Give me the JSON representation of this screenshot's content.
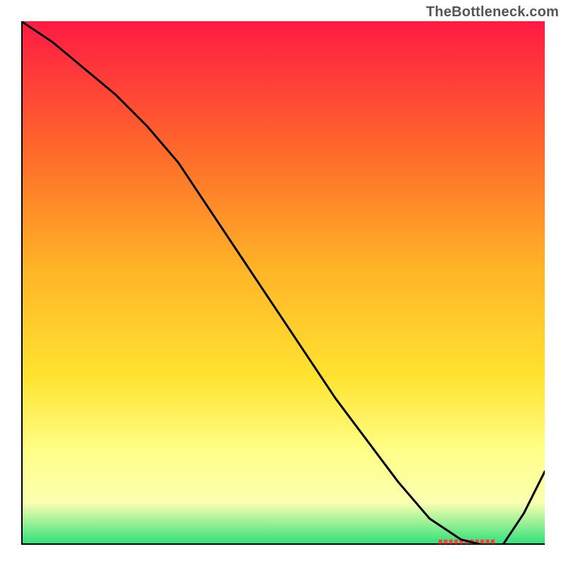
{
  "watermark": "TheBottleneck.com",
  "marker_label": "",
  "colors": {
    "grad_top": "#ff1a44",
    "grad_mid1": "#ff6a2a",
    "grad_mid2": "#ffb627",
    "grad_mid3": "#ffe330",
    "grad_mid4": "#ffff88",
    "grad_mid5": "#fbffb0",
    "grad_bottom": "#2de07a",
    "axis": "#000000",
    "curve": "#000000",
    "marker": "#ff3a3a"
  },
  "chart_data": {
    "type": "line",
    "title": "",
    "xlabel": "",
    "ylabel": "",
    "xlim": [
      0,
      100
    ],
    "ylim": [
      0,
      100
    ],
    "axes_visible": {
      "left": true,
      "bottom": true,
      "ticks": false
    },
    "gradient_stops": [
      {
        "pos": 0.0,
        "color": "#ff1a44"
      },
      {
        "pos": 0.25,
        "color": "#ff6a2a"
      },
      {
        "pos": 0.48,
        "color": "#ffb627"
      },
      {
        "pos": 0.68,
        "color": "#ffe330"
      },
      {
        "pos": 0.82,
        "color": "#ffff88"
      },
      {
        "pos": 0.92,
        "color": "#fbffb0"
      },
      {
        "pos": 1.0,
        "color": "#2de07a"
      }
    ],
    "series": [
      {
        "name": "curve",
        "x": [
          0,
          6,
          12,
          18,
          24,
          30,
          36,
          42,
          48,
          54,
          60,
          66,
          72,
          78,
          84,
          88,
          92,
          96,
          100
        ],
        "y": [
          100,
          96,
          91,
          86,
          80,
          73,
          64,
          55,
          46,
          37,
          28,
          20,
          12,
          5,
          1,
          0,
          0,
          6,
          14
        ]
      }
    ],
    "marker": {
      "x_start": 80,
      "x_end": 90,
      "y": 0.6,
      "label": ""
    }
  }
}
